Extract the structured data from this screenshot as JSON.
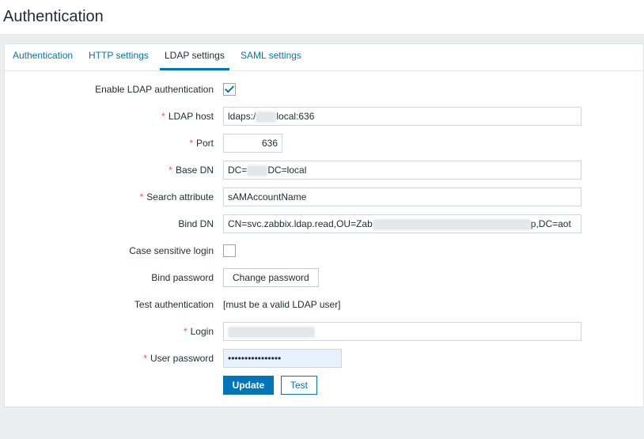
{
  "page": {
    "title": "Authentication"
  },
  "tabs": [
    {
      "label": "Authentication",
      "active": false
    },
    {
      "label": "HTTP settings",
      "active": false
    },
    {
      "label": "LDAP settings",
      "active": true
    },
    {
      "label": "SAML settings",
      "active": false
    }
  ],
  "form": {
    "enable_ldap": {
      "label": "Enable LDAP authentication",
      "checked": true
    },
    "ldap_host": {
      "label": "LDAP host",
      "required": true,
      "value_prefix": "ldaps:/",
      "value_redacted": "xxxxx",
      "value_suffix": "local:636"
    },
    "port": {
      "label": "Port",
      "required": true,
      "value": "636"
    },
    "base_dn": {
      "label": "Base DN",
      "required": true,
      "value_prefix": "DC=",
      "value_redacted": "xxxxx",
      "value_suffix": "DC=local"
    },
    "search_attribute": {
      "label": "Search attribute",
      "required": true,
      "value": "sAMAccountName"
    },
    "bind_dn": {
      "label": "Bind DN",
      "required": false,
      "value_prefix": "CN=svc.zabbix.ldap.read,OU=Zab",
      "value_redacted": "xxxxxxxxxxxxxxxxxxxxxxxxxxxxxxxx",
      "value_suffix": "p,DC=aot"
    },
    "case_sensitive": {
      "label": "Case sensitive login",
      "checked": false
    },
    "bind_password": {
      "label": "Bind password",
      "button_label": "Change password"
    },
    "test_authentication": {
      "label": "Test authentication",
      "note": "[must be a valid LDAP user]"
    },
    "login": {
      "label": "Login",
      "required": true,
      "value_redacted": "xxxxxxxxxxxxxxxxx"
    },
    "user_password": {
      "label": "User password",
      "required": true,
      "value": "••••••••••••••••"
    }
  },
  "actions": {
    "update_label": "Update",
    "test_label": "Test"
  },
  "colors": {
    "accent": "#0275b8",
    "required": "#e45959",
    "autofill": "#e8f0fe"
  }
}
